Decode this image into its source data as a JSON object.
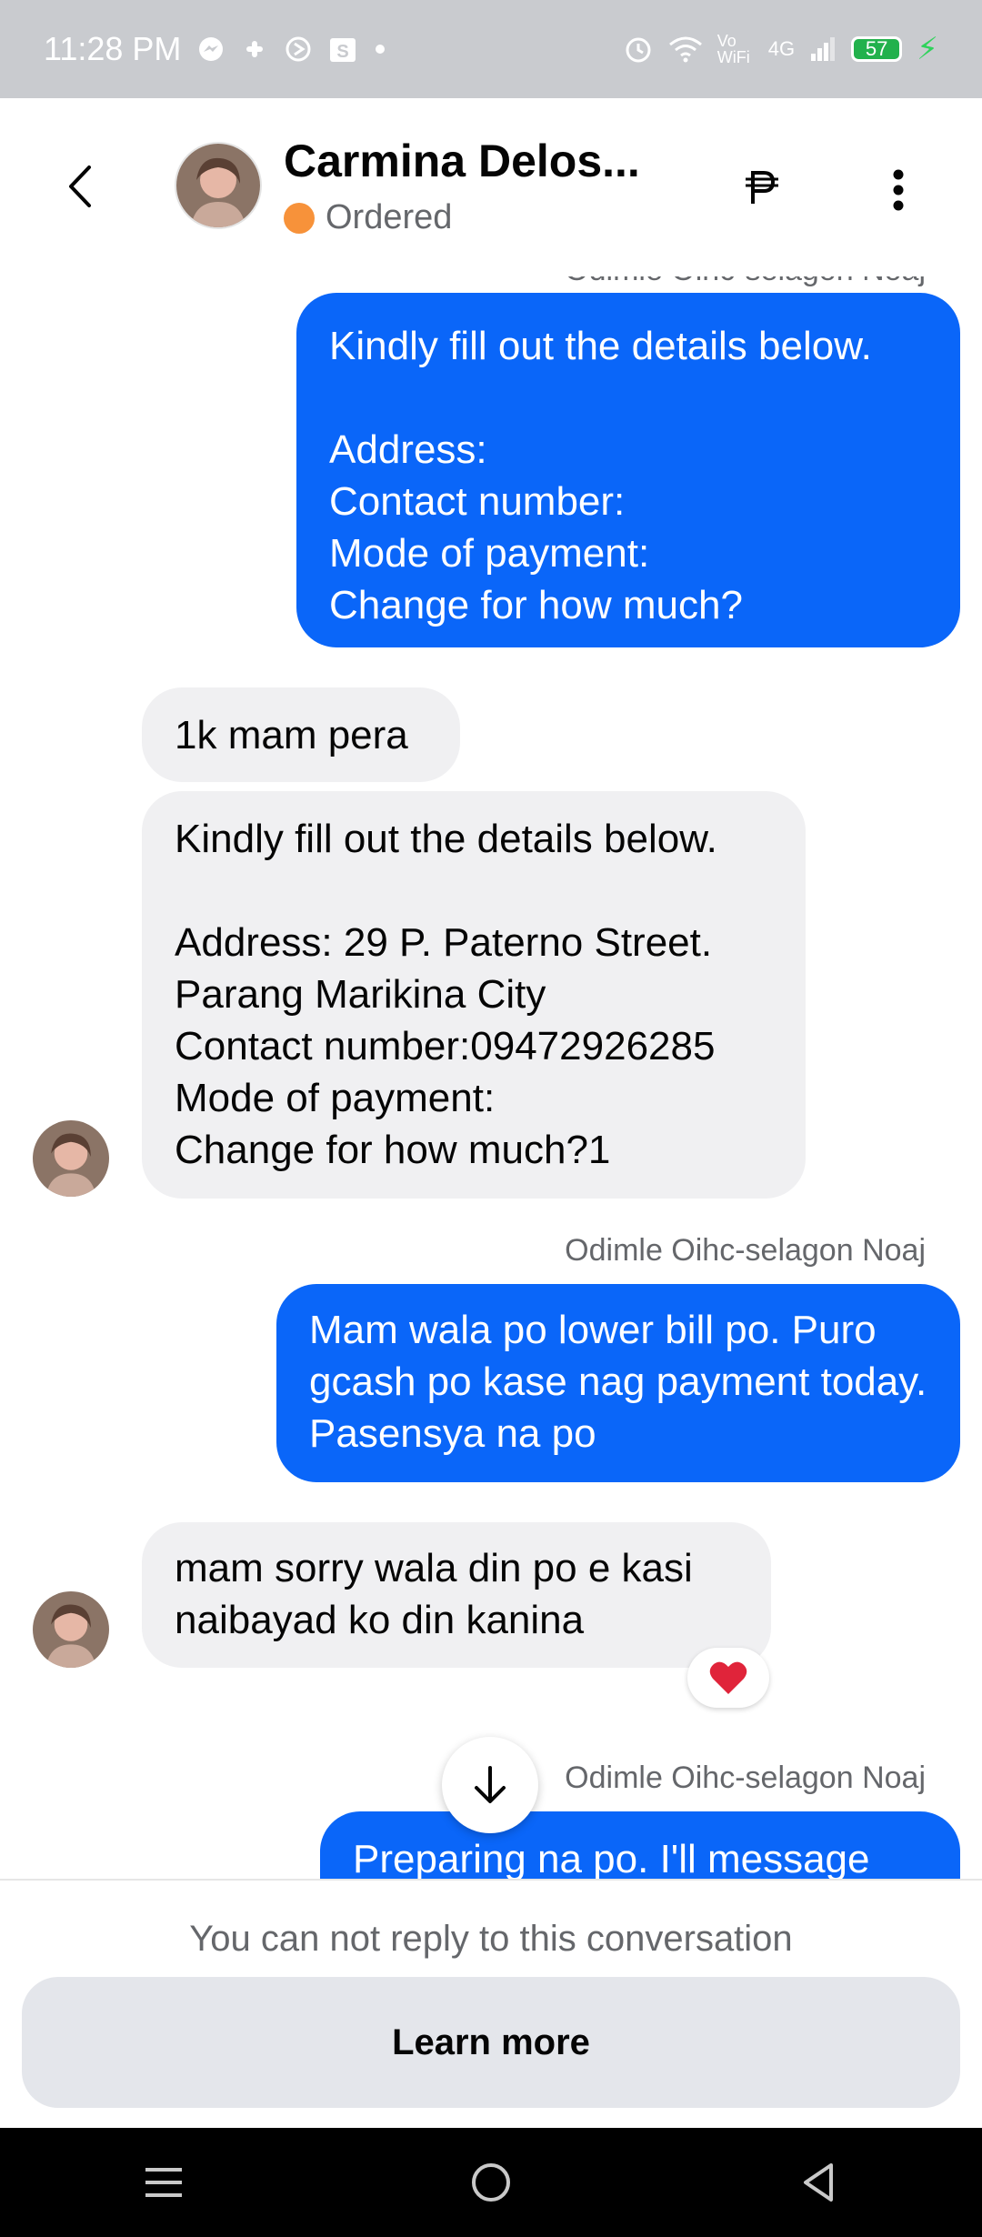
{
  "status_bar": {
    "time": "11:28 PM",
    "wifi_label": "Vo WiFi",
    "network": "4G",
    "battery": "57"
  },
  "header": {
    "name": "Carmina Delos...",
    "status": "Ordered",
    "status_color": "#f7923a"
  },
  "messages": [
    {
      "id": "m1",
      "direction": "out",
      "sender": "",
      "text": "Kindly fill out the details below.\n\nAddress:\nContact number:\nMode of payment:\nChange for how much?"
    },
    {
      "id": "m2",
      "direction": "in",
      "text": "1k mam pera"
    },
    {
      "id": "m3",
      "direction": "in",
      "text": "Kindly fill out the details below.\n\nAddress: 29 P. Paterno Street. Parang Marikina City\nContact number:09472926285\nMode of payment:\nChange for how much?1"
    },
    {
      "id": "m4",
      "direction": "out",
      "sender": "Odimle Oihc-selagon Noaj",
      "text": "Mam wala po lower bill po. Puro gcash po kase nag payment today.  Pasensya na po"
    },
    {
      "id": "m5",
      "direction": "in",
      "text": "mam sorry wala din po e kasi naibayad ko din kanina",
      "reaction": "heart"
    },
    {
      "id": "m6",
      "direction": "out",
      "sender": "Odimle Oihc-selagon Noaj",
      "text": "Preparing na po. I'll message"
    }
  ],
  "footer": {
    "notice": "You can not reply to this conversation",
    "learn_more": "Learn more"
  },
  "colors": {
    "outgoing_bubble": "#0a66f9",
    "incoming_bubble": "#f0f0f2",
    "reaction_heart": "#e0243a"
  }
}
